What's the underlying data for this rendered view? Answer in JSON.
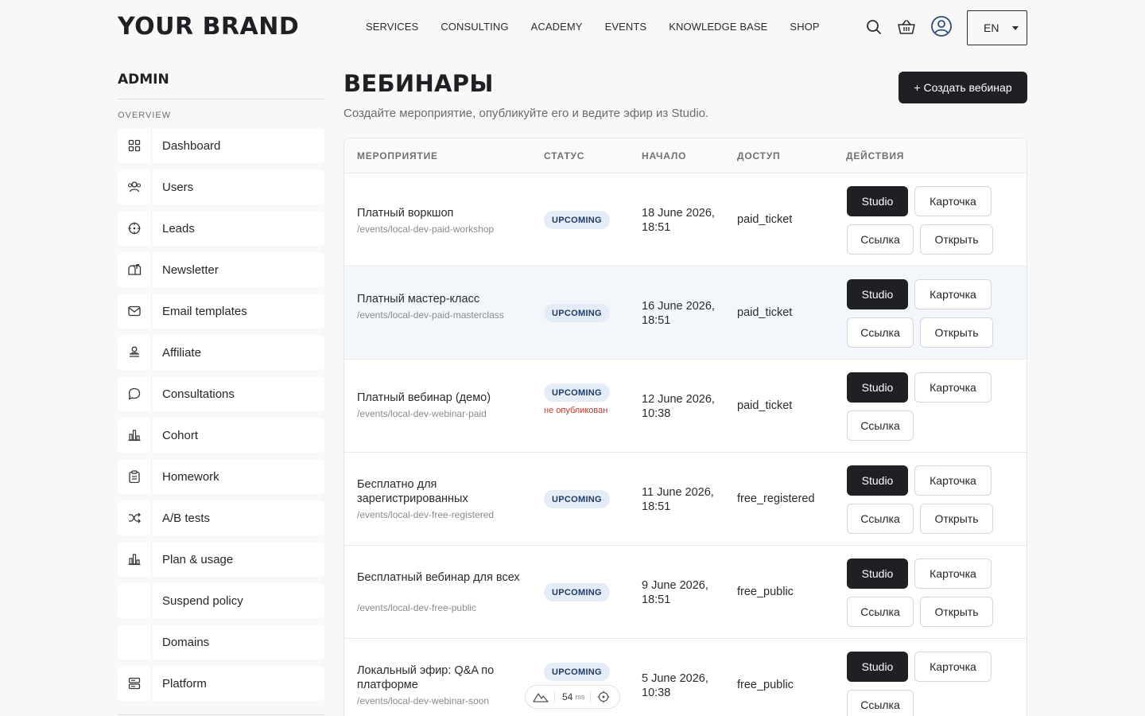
{
  "header": {
    "brand": "YOUR BRAND",
    "nav": [
      "SERVICES",
      "CONSULTING",
      "ACADEMY",
      "EVENTS",
      "KNOWLEDGE BASE",
      "SHOP"
    ],
    "icons": [
      "search-icon",
      "basket-icon",
      "user-icon"
    ],
    "language": "EN"
  },
  "sidebar": {
    "title": "ADMIN",
    "section": "OVERVIEW",
    "items": [
      {
        "label": "Dashboard",
        "icon": "grid-icon"
      },
      {
        "label": "Users",
        "icon": "users-icon"
      },
      {
        "label": "Leads",
        "icon": "target-icon"
      },
      {
        "label": "Newsletter",
        "icon": "mailbox-icon"
      },
      {
        "label": "Email templates",
        "icon": "mail-icon"
      },
      {
        "label": "Affiliate",
        "icon": "affiliate-icon"
      },
      {
        "label": "Consultations",
        "icon": "chat-icon"
      },
      {
        "label": "Cohort",
        "icon": "bar-chart-icon"
      },
      {
        "label": "Homework",
        "icon": "clipboard-icon"
      },
      {
        "label": "A/B tests",
        "icon": "shuffle-icon"
      },
      {
        "label": "Plan & usage",
        "icon": "bar-chart-icon"
      },
      {
        "label": "Suspend policy",
        "icon": ""
      },
      {
        "label": "Domains",
        "icon": ""
      },
      {
        "label": "Platform",
        "icon": "server-icon"
      }
    ]
  },
  "main": {
    "title": "ВЕБИНАРЫ",
    "subtitle": "Создайте мероприятие, опубликуйте его и ведите эфир из Studio.",
    "create_button": "+ Создать вебинар",
    "columns": [
      "МЕРОПРИЯТИЕ",
      "СТАТУС",
      "НАЧАЛО",
      "ДОСТУП",
      "ДЕЙСТВИЯ"
    ],
    "button_labels": {
      "studio": "Studio",
      "card": "Карточка",
      "link": "Ссылка",
      "open": "Открыть"
    },
    "rows": [
      {
        "name": "Платный воркшоп",
        "slug": "/events/local-dev-paid-workshop",
        "status": "UPCOMING",
        "note": "",
        "start": "18 June 2026, 18:51",
        "access": "paid_ticket",
        "has_open": true
      },
      {
        "name": "Платный мастер-класс",
        "slug": "/events/local-dev-paid-masterclass",
        "status": "UPCOMING",
        "note": "",
        "start": "16 June 2026, 18:51",
        "access": "paid_ticket",
        "has_open": true
      },
      {
        "name": "Платный вебинар (демо)",
        "slug": "/events/local-dev-webinar-paid",
        "status": "UPCOMING",
        "note": "не опубликован",
        "start": "12 June 2026, 10:38",
        "access": "paid_ticket",
        "has_open": false
      },
      {
        "name": "Бесплатно для зарегистрированных",
        "slug": "/events/local-dev-free-registered",
        "status": "UPCOMING",
        "note": "",
        "start": "11 June 2026, 18:51",
        "access": "free_registered",
        "has_open": true
      },
      {
        "name": "Бесплатный вебинар для всех",
        "slug": "/events/local-dev-free-public",
        "status": "UPCOMING",
        "note": "",
        "start": "9 June 2026, 18:51",
        "access": "free_public",
        "has_open": true
      },
      {
        "name": "Локальный эфир: Q&A по платформе",
        "slug": "/events/local-dev-webinar-soon",
        "status": "UPCOMING",
        "note": "",
        "start": "5 June 2026, 10:38",
        "access": "free_public",
        "has_open": false
      }
    ]
  },
  "perf_widget": {
    "value": "54",
    "unit": "ms"
  }
}
